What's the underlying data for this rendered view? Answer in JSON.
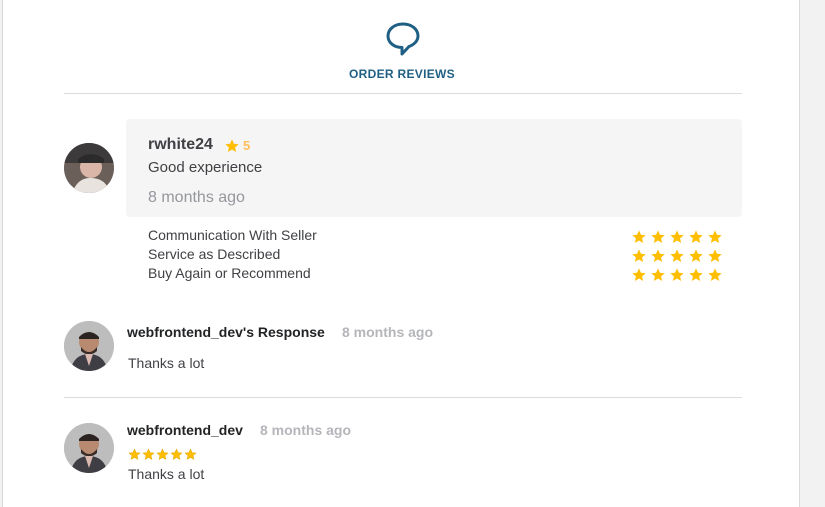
{
  "header": {
    "title": "ORDER REVIEWS",
    "icon": "speech-bubble-icon",
    "accent": "#1f5f84"
  },
  "review": {
    "username": "rwhite24",
    "rating": "5",
    "text": "Good experience",
    "time": "8 months ago",
    "criteria": [
      {
        "label": "Communication With Seller",
        "stars": 5
      },
      {
        "label": "Service as Described",
        "stars": 5
      },
      {
        "label": "Buy Again or Recommend",
        "stars": 5
      }
    ]
  },
  "seller_response": {
    "name": "webfrontend_dev's Response",
    "time": "8 months ago",
    "text": "Thanks a lot"
  },
  "seller_review": {
    "name": "webfrontend_dev",
    "time": "8 months ago",
    "stars": 5,
    "text": "Thanks a lot"
  },
  "colors": {
    "star": "#ffbe00",
    "muted": "#95979d"
  }
}
